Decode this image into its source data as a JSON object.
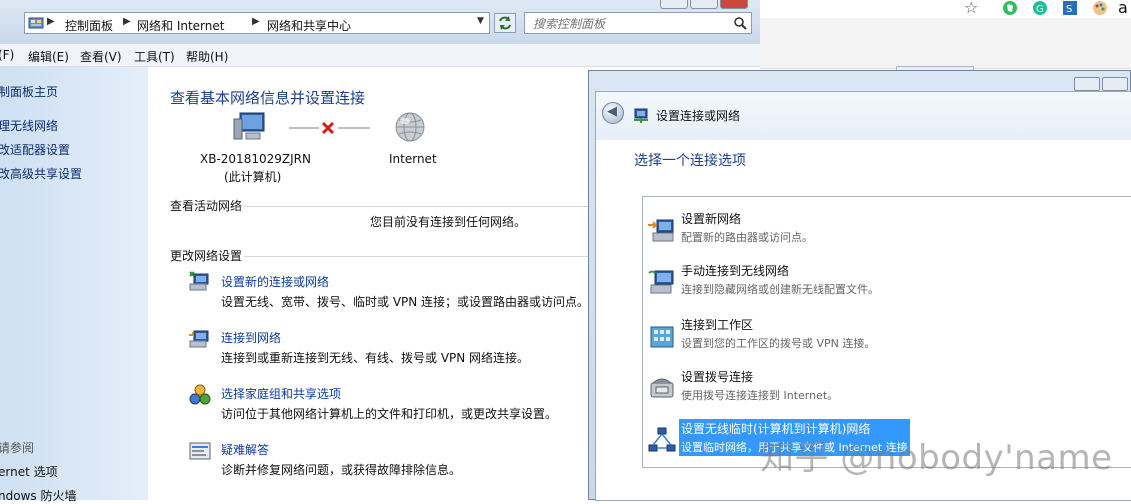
{
  "main_window": {
    "breadcrumb": [
      "控制面板",
      "网络和 Internet",
      "网络和共享中心"
    ],
    "search_placeholder": "搜索控制面板",
    "menu": [
      "(F)",
      "编辑(E)",
      "查看(V)",
      "工具(T)",
      "帮助(H)"
    ],
    "sidebar": {
      "links": [
        "制面板主页",
        "理无线网络",
        "改适配器设置",
        "改高级共享设置"
      ],
      "see_also_title": "请参阅",
      "see_also_links": [
        "ernet 选项",
        "ndows 防火墙"
      ]
    },
    "content": {
      "title": "查看基本网络信息并设置连接",
      "computer_name": "XB-20181029ZJRN",
      "computer_sub": "(此计算机)",
      "internet_label": "Internet",
      "active_networks_header": "查看活动网络",
      "no_connection_text": "您目前没有连接到任何网络。",
      "change_settings_header": "更改网络设置",
      "tasks": [
        {
          "title": "设置新的连接或网络",
          "desc": "设置无线、宽带、拨号、临时或 VPN 连接；或设置路由器或访问点。"
        },
        {
          "title": "连接到网络",
          "desc": "连接到或重新连接到无线、有线、拨号或 VPN 网络连接。"
        },
        {
          "title": "选择家庭组和共享选项",
          "desc": "访问位于其他网络计算机上的文件和打印机，或更改共享设置。"
        },
        {
          "title": "疑难解答",
          "desc": "诊断并修复网络问题，或获得故障排除信息。"
        }
      ]
    }
  },
  "dialog": {
    "title": "设置连接或网络",
    "prompt": "选择一个连接选项",
    "options": [
      {
        "title": "设置新网络",
        "desc": "配置新的路由器或访问点。"
      },
      {
        "title": "手动连接到无线网络",
        "desc": "连接到隐藏网络或创建新无线配置文件。"
      },
      {
        "title": "连接到工作区",
        "desc": "设置到您的工作区的拨号或 VPN 连接。"
      },
      {
        "title": "设置拨号连接",
        "desc": "使用拨号连接连接到 Internet。"
      },
      {
        "title": "设置无线临时(计算机到计算机)网络",
        "desc": "设置临时网络，用于共享文件或 Internet 连接"
      }
    ],
    "selected_index": 4
  },
  "browser": {
    "extension_letter": "a"
  },
  "watermark": "知乎 @nobody'name",
  "colors": {
    "link": "#0d3ba0",
    "title": "#1d3f8b",
    "selection": "#3399ff"
  }
}
